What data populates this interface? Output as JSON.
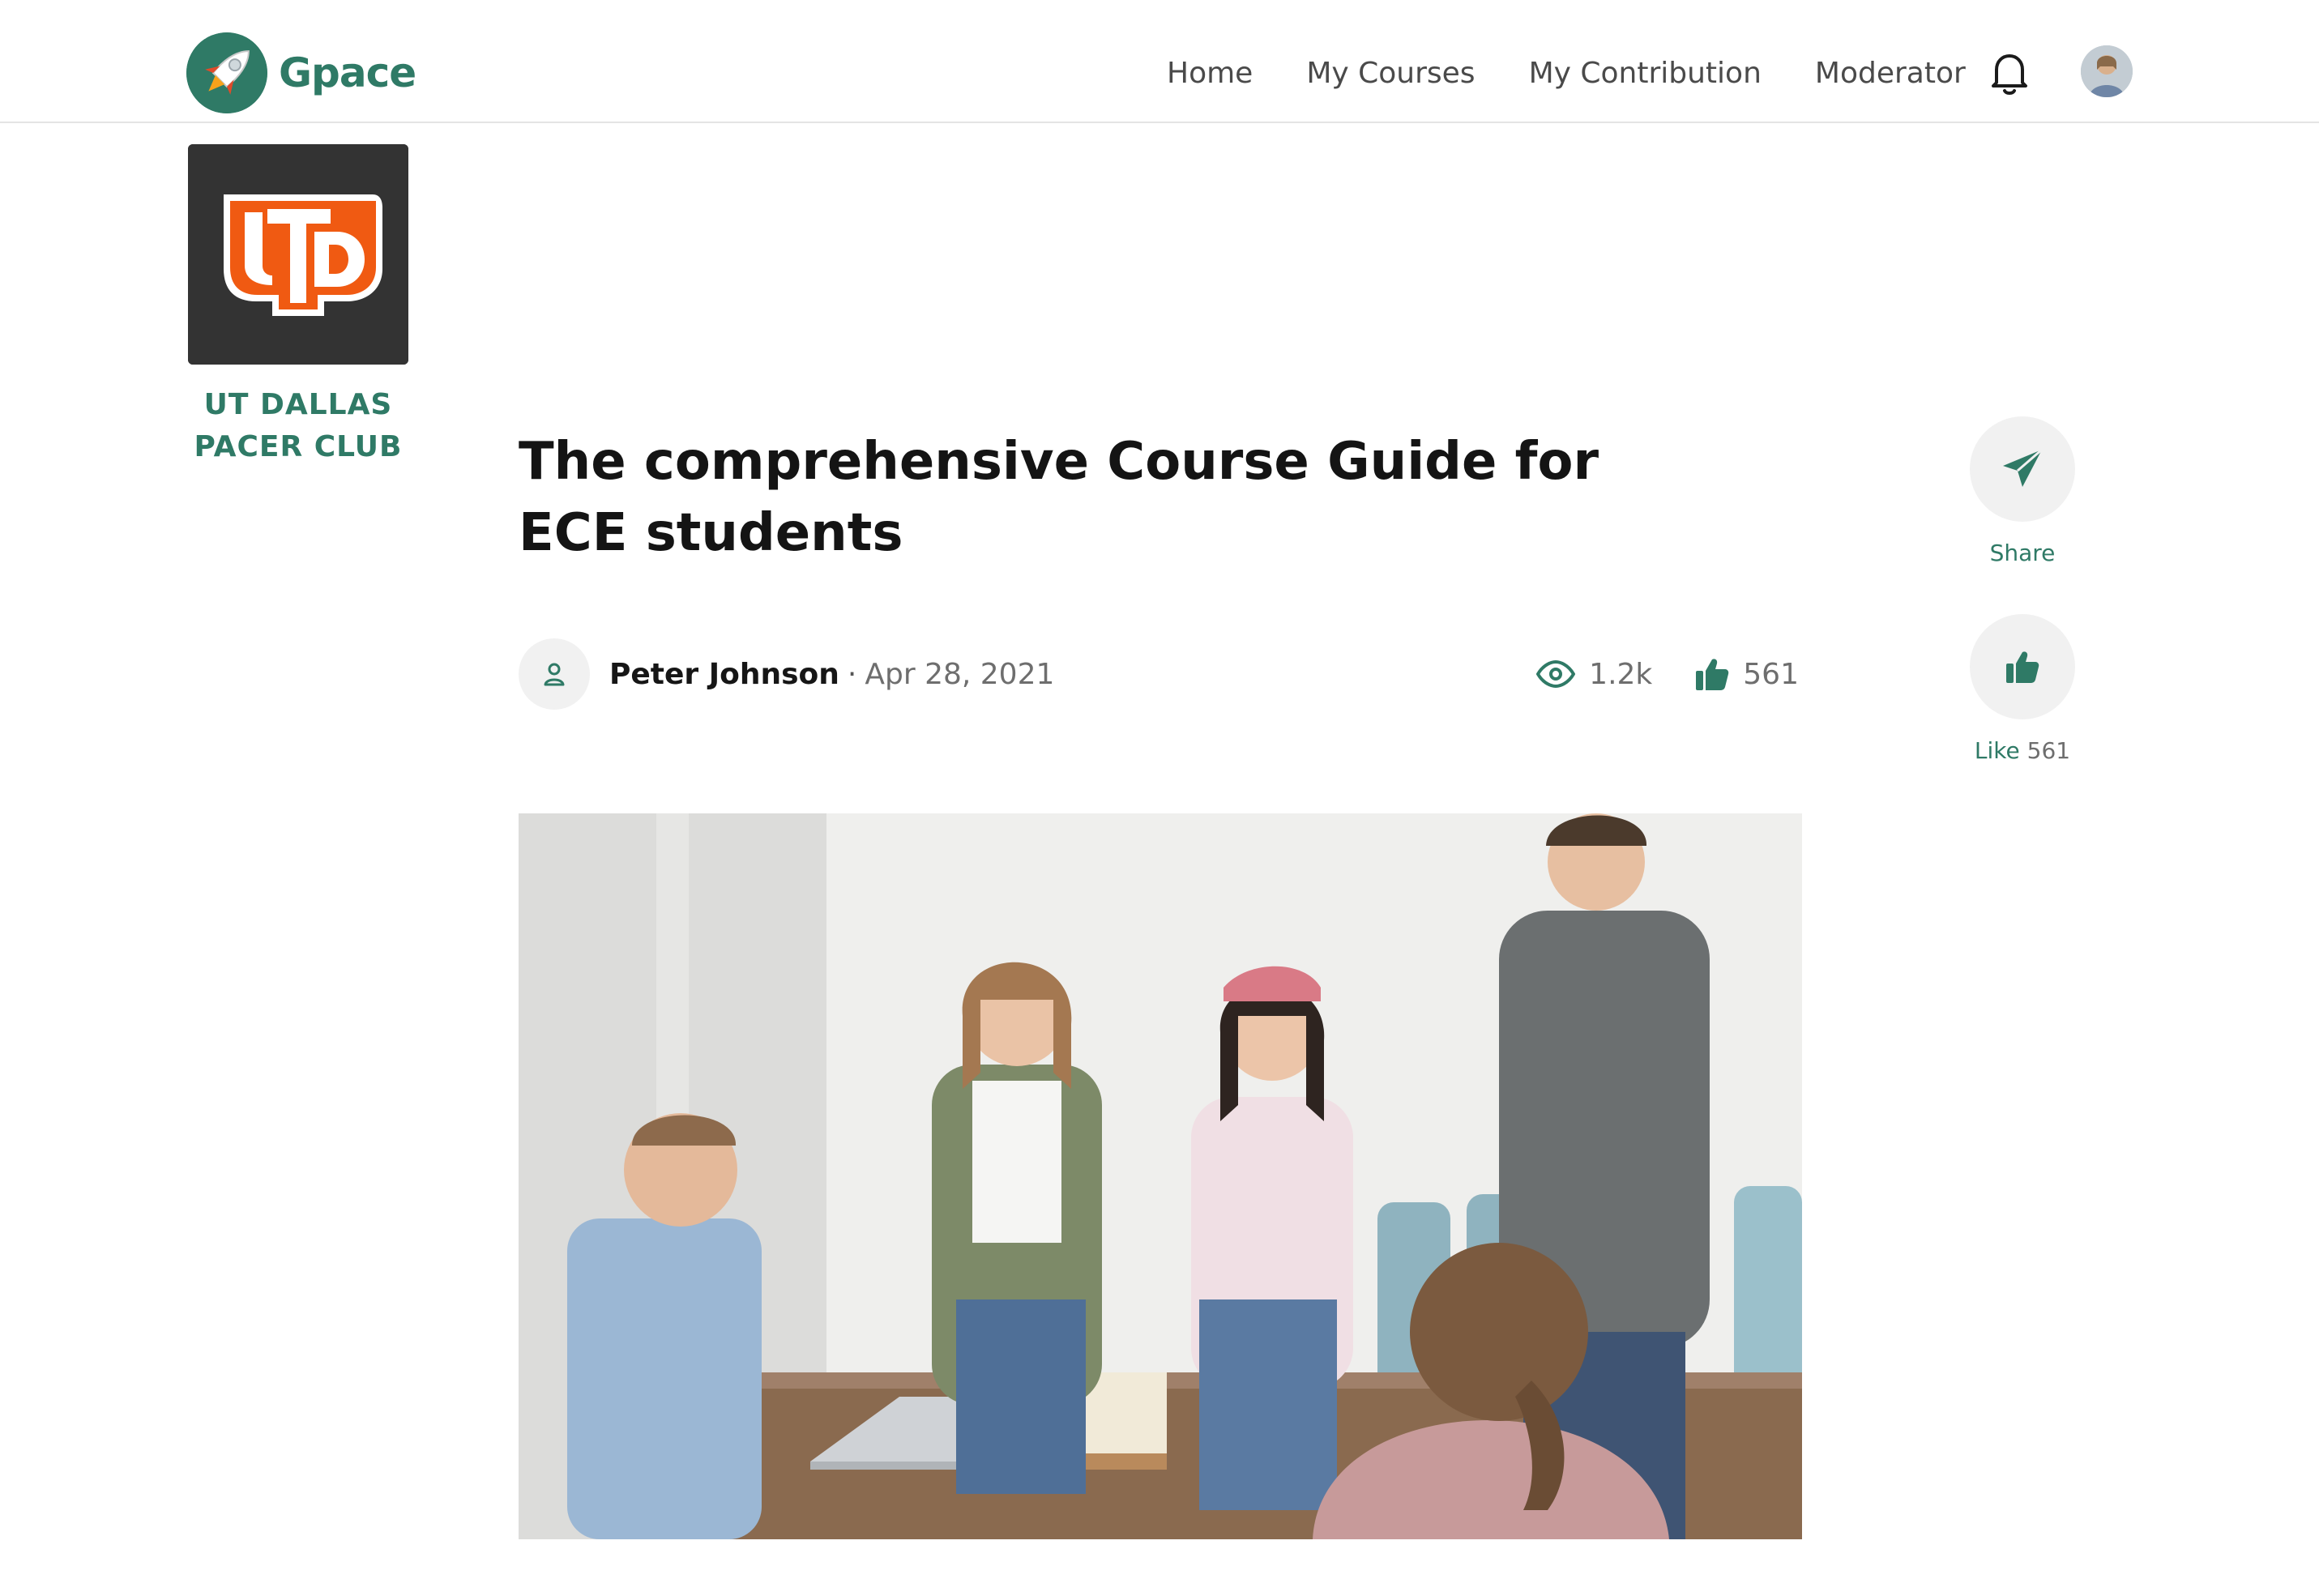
{
  "header": {
    "brand_name": "Gpace",
    "brand_icon": "rocket-logo-icon",
    "nav": [
      {
        "label": "Home"
      },
      {
        "label": "My Courses"
      },
      {
        "label": "My Contribution"
      },
      {
        "label": "Moderator"
      }
    ],
    "notification_icon": "bell-icon",
    "avatar_icon": "user-avatar"
  },
  "club": {
    "logo_text": "UTD",
    "name_line1": "UT DALLAS",
    "name_line2": "PACER CLUB"
  },
  "article": {
    "title": "The comprehensive Course Guide for ECE students",
    "author": "Peter Johnson",
    "separator": "·",
    "date": "Apr 28, 2021",
    "views": "1.2k",
    "likes": "561"
  },
  "actions": {
    "share_label": "Share",
    "like_label": "Like",
    "like_count": "561"
  },
  "colors": {
    "accent": "#2f7a66",
    "muted_text": "#6e6e6e",
    "club_orange": "#f05a12",
    "club_logo_bg": "#333333"
  }
}
